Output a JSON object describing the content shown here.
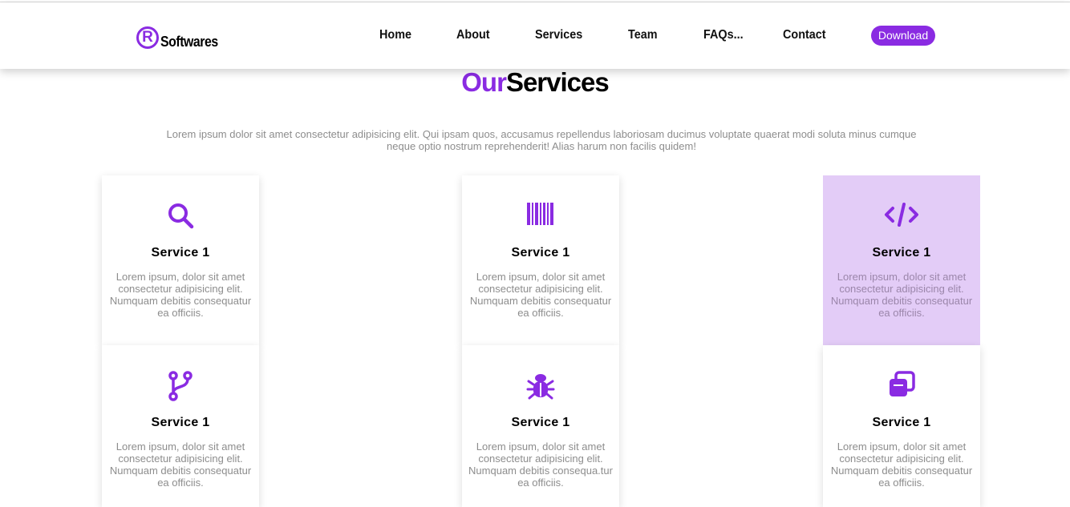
{
  "brand": {
    "logo_mark": "R",
    "name": "Softwares",
    "accent": "#8a2be2"
  },
  "nav": {
    "items": [
      "Home",
      "About",
      "Services",
      "Team",
      "FAQs...",
      "Contact"
    ],
    "download_label": "Download"
  },
  "section": {
    "title_part1": "Our",
    "title_part2": "Services",
    "intro": "Lorem ipsum dolor sit amet consectetur adipisicing elit. Qui ipsam quos, accusamus repellendus laboriosam ducimus voluptate quaerat modi soluta minus cumque neque optio nostrum reprehenderit! Alias harum non facilis quidem!"
  },
  "services": [
    {
      "icon": "search-icon",
      "title": "Service 1",
      "text": "Lorem ipsum, dolor sit amet consectetur adipisicing elit. Numquam debitis consequatur ea officiis."
    },
    {
      "icon": "barcode-icon",
      "title": "Service 1",
      "text": "Lorem ipsum, dolor sit amet consectetur adipisicing elit. Numquam debitis consequatur ea officiis."
    },
    {
      "icon": "code-icon",
      "title": "Service 1",
      "text": "Lorem ipsum, dolor sit amet consectetur adipisicing elit. Numquam debitis consequatur ea officiis.",
      "highlighted": true
    },
    {
      "icon": "code-branch-icon",
      "title": "Service 1",
      "text": "Lorem ipsum, dolor sit amet consectetur adipisicing elit. Numquam debitis consequatur ea officiis."
    },
    {
      "icon": "bug-icon",
      "title": "Service 1",
      "text": "Lorem ipsum, dolor sit amet consectetur adipisicing elit. Numquam debitis consequa.tur ea officiis."
    },
    {
      "icon": "clone-icon",
      "title": "Service 1",
      "text": "Lorem ipsum, dolor sit amet consectetur adipisicing elit. Numquam debitis consequatur ea officiis."
    }
  ]
}
